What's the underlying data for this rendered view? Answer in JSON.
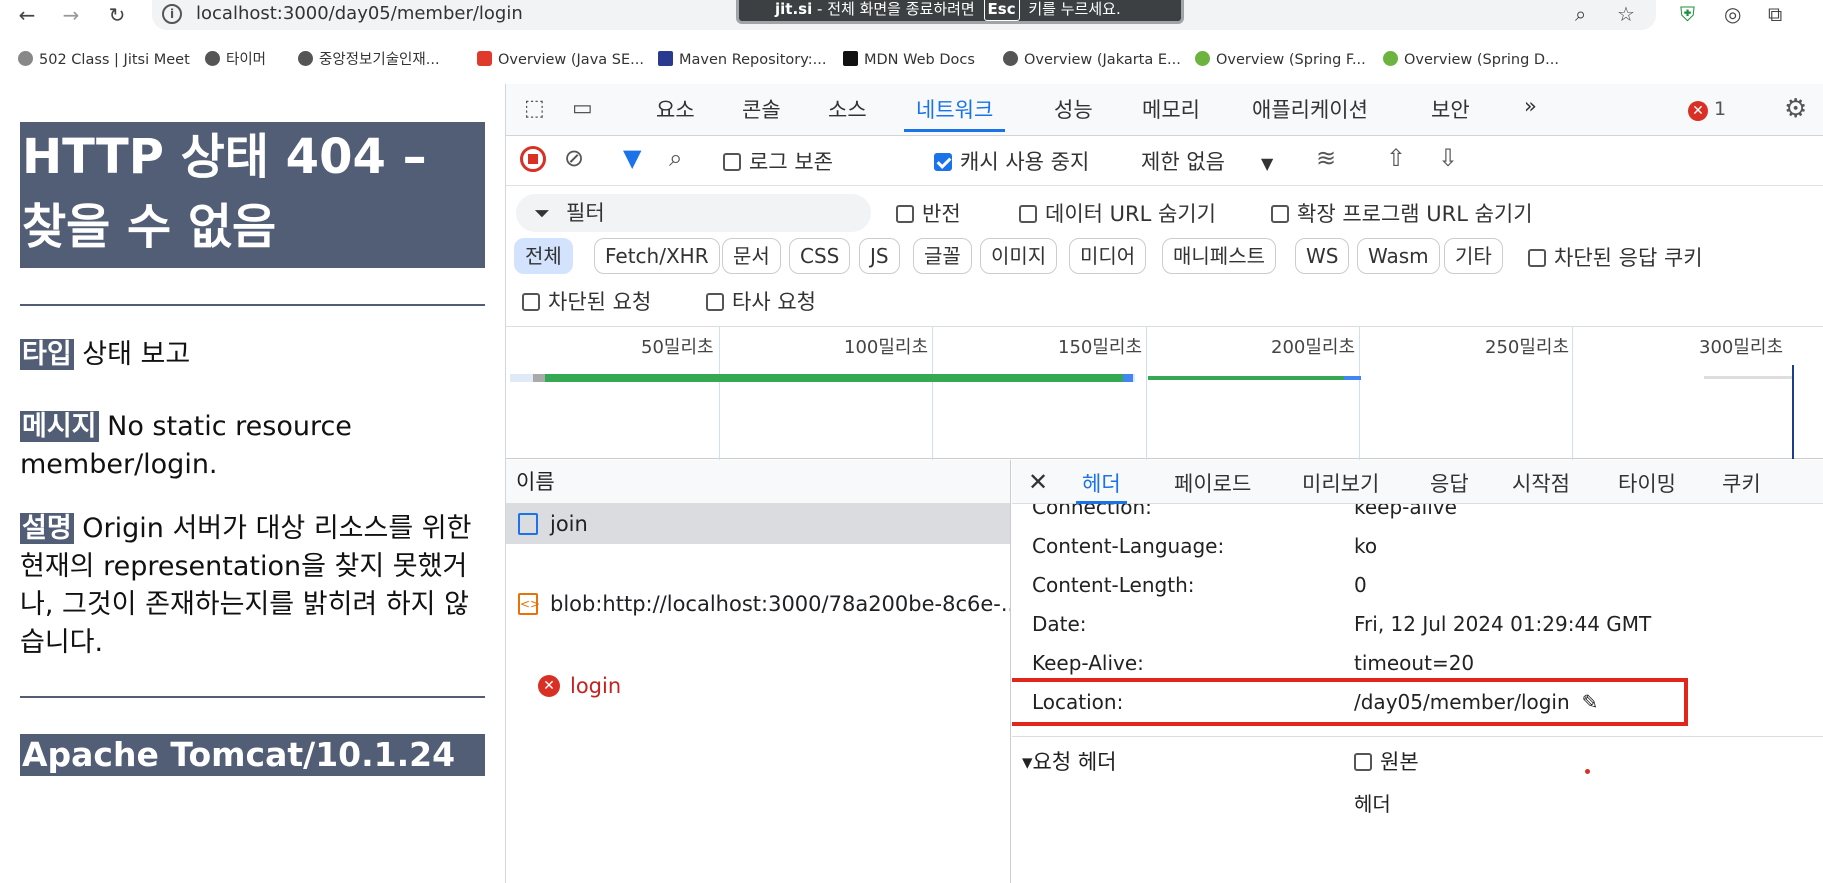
{
  "browser": {
    "url": "localhost:3000/day05/member/login",
    "fullscreen_toast": {
      "site": "jit.si",
      "before": "- 전체 화면을 종료하려면",
      "key": "Esc",
      "after": "키를 누르세요."
    },
    "bookmarks": [
      {
        "label": "502 Class | Jitsi Meet",
        "color": "#888888"
      },
      {
        "label": "타이머",
        "color": "#555555"
      },
      {
        "label": "중앙정보기술인재...",
        "color": "#555555"
      },
      {
        "label": "Overview (Java SE...",
        "color": "#e03a2d"
      },
      {
        "label": "Maven Repository:...",
        "color": "#2a3b8f"
      },
      {
        "label": "MDN Web Docs",
        "color": "#111111"
      },
      {
        "label": "Overview (Jakarta E...",
        "color": "#555555"
      },
      {
        "label": "Overview (Spring F...",
        "color": "#6db33f"
      },
      {
        "label": "Overview (Spring D...",
        "color": "#6db33f"
      }
    ]
  },
  "error_page": {
    "title": "HTTP 상태 404 – 찾을 수 없음",
    "type_label": "타입",
    "type_value": "상태 보고",
    "message_label": "메시지",
    "message_value": "No static resource member/login.",
    "desc_label": "설명",
    "desc_value": "Origin 서버가 대상 리소스를 위한 현재의 representation을 찾지 못했거나, 그것이 존재하는지를 밝히려 하지 않습니다.",
    "footer": "Apache Tomcat/10.1.24"
  },
  "devtools": {
    "tabs": [
      "요소",
      "콘솔",
      "소스",
      "네트워크",
      "성능",
      "메모리",
      "애플리케이션",
      "보안"
    ],
    "active_tab": "네트워크",
    "error_count": "1",
    "toolbar": {
      "preserve_log": "로그 보존",
      "disable_cache": "캐시 사용 중지",
      "throttle": "제한 없음"
    },
    "filter": {
      "placeholder": "필터",
      "invert": "반전",
      "hide_data_urls": "데이터 URL 숨기기",
      "hide_ext_urls": "확장 프로그램 URL 숨기기"
    },
    "type_filters": [
      "전체",
      "Fetch/XHR",
      "문서",
      "CSS",
      "JS",
      "글꼴",
      "이미지",
      "미디어",
      "매니페스트",
      "WS",
      "Wasm",
      "기타"
    ],
    "blocked_cookies": "차단된 응답 쿠키",
    "blocked_requests": "차단된 요청",
    "third_party": "타사 요청",
    "timeline_ticks": [
      "50밀리초",
      "100밀리초",
      "150밀리초",
      "200밀리초",
      "250밀리초",
      "300밀리초"
    ],
    "request_list": {
      "header": "이름",
      "rows": [
        {
          "name": "join",
          "status": "doc"
        },
        {
          "name": "login",
          "status": "error"
        },
        {
          "name": "blob:http://localhost:3000/78a200be-8c6e-...",
          "status": "blob"
        }
      ]
    },
    "detail_tabs": [
      "헤더",
      "페이로드",
      "미리보기",
      "응답",
      "시작점",
      "타이밍",
      "쿠키"
    ],
    "headers": [
      {
        "k": "Connection:",
        "v": "keep-alive"
      },
      {
        "k": "Content-Language:",
        "v": "ko"
      },
      {
        "k": "Content-Length:",
        "v": "0"
      },
      {
        "k": "Date:",
        "v": "Fri, 12 Jul 2024 01:29:44 GMT"
      },
      {
        "k": "Keep-Alive:",
        "v": "timeout=20"
      },
      {
        "k": "Location:",
        "v": "/day05/member/login"
      }
    ],
    "request_headers_label": "▾요청 헤더",
    "raw_label": "원본",
    "header_sub": "헤더"
  }
}
